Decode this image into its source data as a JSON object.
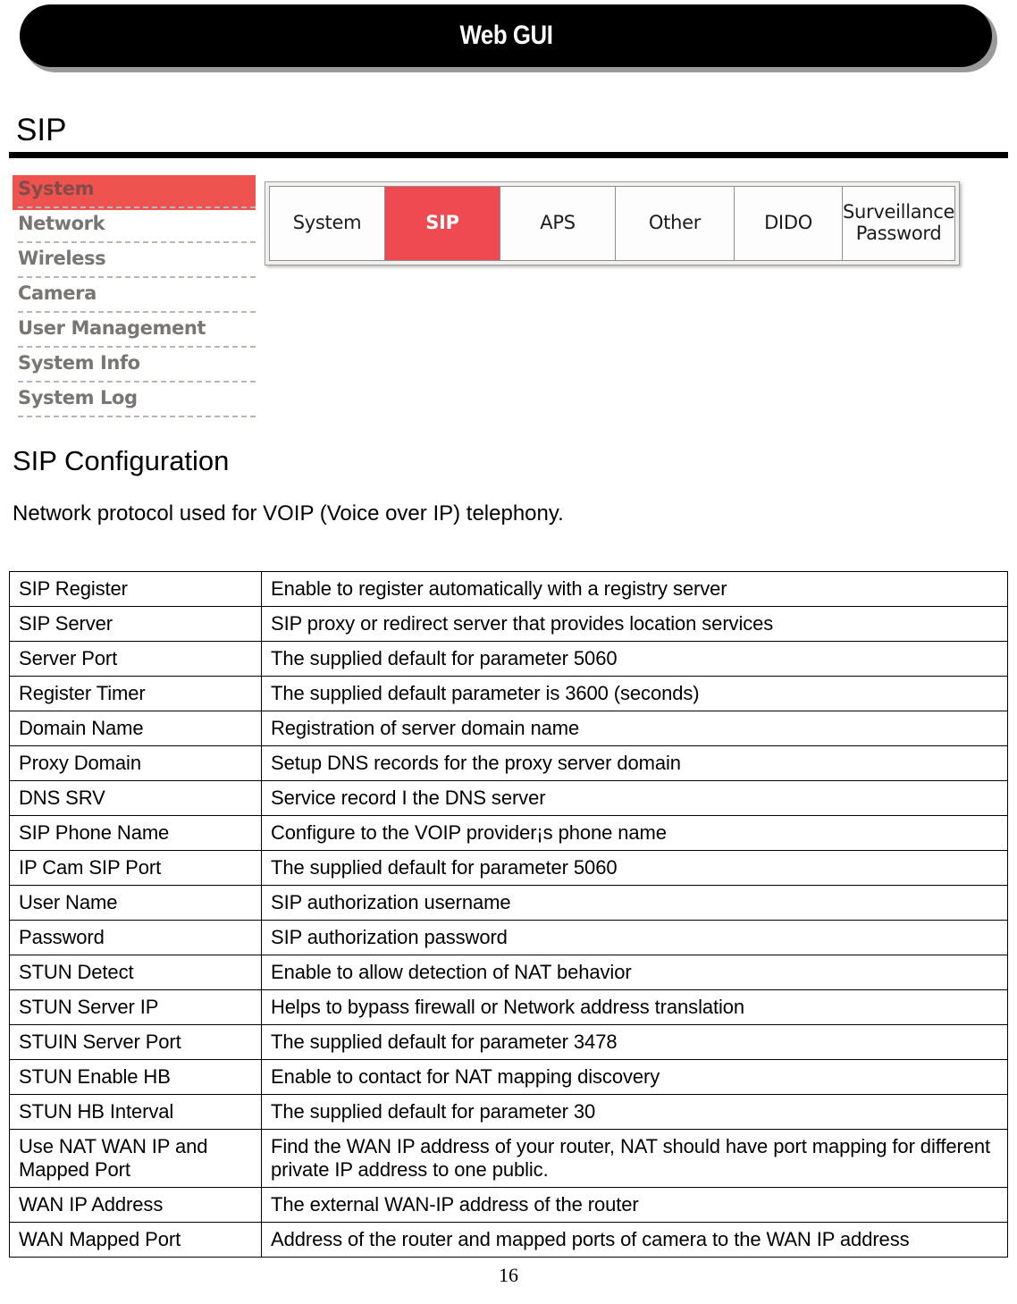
{
  "banner": {
    "title": "Web GUI"
  },
  "heading": {
    "title": "SIP"
  },
  "sidebar": {
    "items": [
      {
        "label": "System",
        "active": true
      },
      {
        "label": "Network",
        "active": false
      },
      {
        "label": "Wireless",
        "active": false
      },
      {
        "label": "Camera",
        "active": false
      },
      {
        "label": "User Management",
        "active": false
      },
      {
        "label": "System Info",
        "active": false
      },
      {
        "label": "System Log",
        "active": false
      }
    ]
  },
  "tabbar": {
    "tabs": [
      {
        "label": "System",
        "active": false
      },
      {
        "label": "SIP",
        "active": true
      },
      {
        "label": "APS",
        "active": false
      },
      {
        "label": "Other",
        "active": false
      },
      {
        "label": "DIDO",
        "active": false
      },
      {
        "label": "Surveillance Password",
        "active": false
      }
    ],
    "active_color": "#ef4a52"
  },
  "section": {
    "title": "SIP Configuration",
    "description": "Network protocol used for VOIP (Voice over IP) telephony."
  },
  "table": {
    "rows": [
      {
        "term": "SIP Register",
        "desc": "Enable to register automatically with a registry server"
      },
      {
        "term": "SIP Server",
        "desc": "SIP proxy or redirect server that provides location services"
      },
      {
        "term": "Server Port",
        "desc": "The supplied default for parameter 5060"
      },
      {
        "term": "Register Timer",
        "desc": "The supplied default parameter is 3600 (seconds)"
      },
      {
        "term": "Domain Name",
        "desc": "Registration of server domain name"
      },
      {
        "term": "Proxy Domain",
        "desc": "Setup DNS records for the proxy server domain"
      },
      {
        "term": "DNS SRV",
        "desc": "Service record I the DNS server"
      },
      {
        "term": "SIP Phone Name",
        "desc": "Configure to the VOIP provider¡s phone name"
      },
      {
        "term": "IP Cam SIP Port",
        "desc": "The supplied default for parameter 5060"
      },
      {
        "term": "User Name",
        "desc": "SIP authorization username"
      },
      {
        "term": "Password",
        "desc": "SIP authorization password"
      },
      {
        "term": "STUN Detect",
        "desc": "Enable to allow detection of NAT behavior"
      },
      {
        "term": "STUN Server IP",
        "desc": "Helps to bypass firewall or Network address translation"
      },
      {
        "term": "STUIN Server Port",
        "desc": "The supplied default for parameter 3478"
      },
      {
        "term": "STUN Enable HB",
        "desc": "Enable to contact for NAT mapping discovery"
      },
      {
        "term": "STUN HB Interval",
        "desc": "The supplied default for parameter 30"
      },
      {
        "term": "Use NAT WAN IP and Mapped Port",
        "desc": "Find the WAN IP address of your router, NAT should have port mapping for different private IP address to one public."
      },
      {
        "term": "WAN IP Address",
        "desc": "The external WAN-IP address of the router"
      },
      {
        "term": "WAN Mapped Port",
        "desc": "Address of the router and mapped ports of camera to the WAN IP address"
      }
    ]
  },
  "footer": {
    "page_number": "16"
  }
}
